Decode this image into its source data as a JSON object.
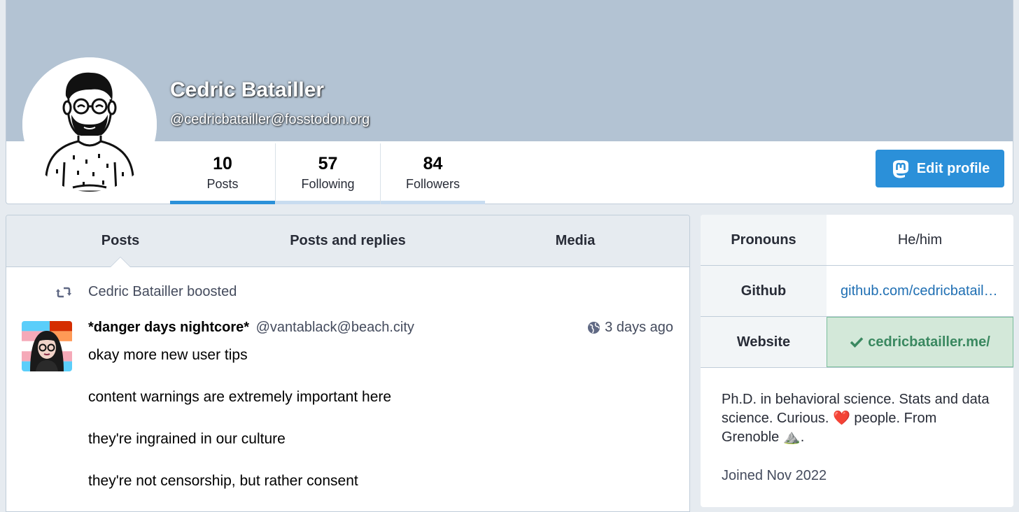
{
  "profile": {
    "display_name": "Cedric Batailler",
    "handle": "@cedricbatailler@fosstodon.org",
    "banner_color": "#b3c3d3",
    "avatar_icon": "cartoon-bearded-man-avatar"
  },
  "counters": [
    {
      "value": "10",
      "label": "Posts",
      "active": true
    },
    {
      "value": "57",
      "label": "Following",
      "active": false
    },
    {
      "value": "84",
      "label": "Followers",
      "active": false
    }
  ],
  "actions": {
    "edit_profile_label": "Edit profile",
    "edit_profile_icon": "mastodon-logo-icon",
    "accent_color": "#2b90d9"
  },
  "tabs": [
    {
      "label": "Posts",
      "active": true
    },
    {
      "label": "Posts and replies",
      "active": false
    },
    {
      "label": "Media",
      "active": false
    }
  ],
  "status": {
    "boost_text": "Cedric Batailler boosted",
    "author_name": "*danger days nightcore*",
    "author_acct": "@vantablack@beach.city",
    "visibility_icon": "globe-icon",
    "time": "3 days ago",
    "paragraphs": [
      "okay more new user tips",
      "content warnings are extremely important here",
      "they're ingrained in our culture",
      "they're not censorship, but rather consent"
    ]
  },
  "fields": [
    {
      "name": "Pronouns",
      "value": "He/him",
      "type": "text"
    },
    {
      "name": "Github",
      "value": "github.com/cedricbataill…",
      "type": "link"
    },
    {
      "name": "Website",
      "value": "cedricbatailler.me/",
      "type": "verified"
    }
  ],
  "bio": {
    "part1": "Ph.D. in behavioral science. Stats and data science. Curious. ",
    "heart": "❤️",
    "part2": " people. From Grenoble ",
    "mountain": "⛰️",
    "part3": "."
  },
  "joined": "Joined Nov 2022"
}
